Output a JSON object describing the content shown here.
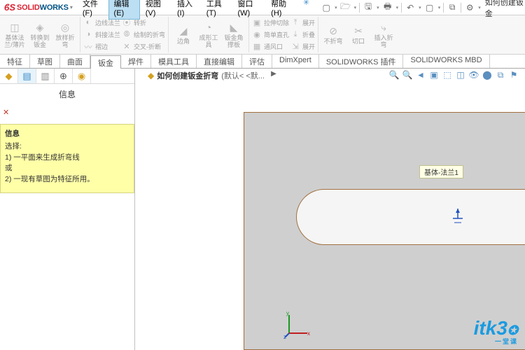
{
  "app": {
    "name_solid": "SOLID",
    "name_works": "WORKS",
    "ds": "DS"
  },
  "menu": {
    "file": "文件(F)",
    "edit": "编辑(E)",
    "view": "视图(V)",
    "insert": "插入(I)",
    "tools": "工具(T)",
    "window": "窗口(W)",
    "help": "帮助(H)"
  },
  "title_doc": "如何创建钣金",
  "ribbon": {
    "g1": {
      "base_flange": "基体法\n兰/薄片",
      "convert": "转换到\n钣金",
      "lofted": "放样折\n弯"
    },
    "g2": {
      "edge_flange": "边线法兰",
      "miter_flange": "斜接法兰",
      "hem": "褶边",
      "jog": "转折",
      "sketched_bend": "绘制的折弯",
      "cross_break": "交叉-折断"
    },
    "g3": {
      "edge": "边角",
      "form_tool": "成形工\n具",
      "gusset": "钣金角\n撑板"
    },
    "g4": {
      "extruded_cut": "拉伸切除",
      "simple_hole": "简单直孔",
      "vent": "通风口",
      "unfold": "展开",
      "fold": "折叠",
      "unfold2": "展开"
    },
    "g5": {
      "no_bend": "不折弯",
      "rip": "切口",
      "insert_bend": "插入折\n弯"
    }
  },
  "tabs": {
    "feature": "特征",
    "sketch": "草图",
    "surface": "曲面",
    "sheetmetal": "钣金",
    "weldment": "焊件",
    "mold": "模具工具",
    "direct": "直接编辑",
    "evaluate": "评估",
    "dimxpert": "DimXpert",
    "plugins": "SOLIDWORKS 插件",
    "mbd": "SOLIDWORKS MBD"
  },
  "panel": {
    "title": "信息",
    "info_header": "信息",
    "select_label": "选择:",
    "line1": "1) 一平面来生成折弯线",
    "or": "或",
    "line2": "2) 一现有草图为特征所用。"
  },
  "doc": {
    "name": "如何创建钣金折弯",
    "config": "(默认< <默..."
  },
  "annotation": {
    "label": "基体-法兰1"
  },
  "triad": {
    "x": "x",
    "y": "y",
    "z": "z"
  },
  "watermark": {
    "main": "itk3",
    "sub": "一堂课"
  }
}
